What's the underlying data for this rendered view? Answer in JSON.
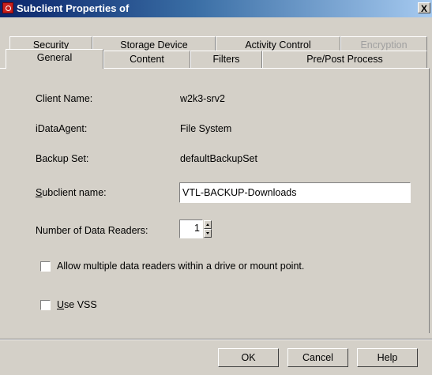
{
  "window": {
    "title": "Subclient Properties of",
    "close_glyph": "X"
  },
  "tabs": {
    "back_row": [
      {
        "label": "Security",
        "disabled": false
      },
      {
        "label": "Storage Device",
        "disabled": false
      },
      {
        "label": "Activity Control",
        "disabled": false
      },
      {
        "label": "Encryption",
        "disabled": true
      }
    ],
    "front_row": [
      {
        "label": "General",
        "selected": true
      },
      {
        "label": "Content",
        "selected": false
      },
      {
        "label": "Filters",
        "selected": false
      },
      {
        "label": "Pre/Post Process",
        "selected": false
      }
    ]
  },
  "general": {
    "client_name_label": "Client Name:",
    "client_name_value": "w2k3-srv2",
    "idataagent_label": "iDataAgent:",
    "idataagent_value": "File System",
    "backup_set_label": "Backup Set:",
    "backup_set_value": "defaultBackupSet",
    "subclient_name_label_mnemonic": "S",
    "subclient_name_label_rest": "ubclient name:",
    "subclient_name_value": "VTL-BACKUP-Downloads",
    "data_readers_label": "Number of Data Readers:",
    "data_readers_value": "1",
    "allow_multiple_label": "Allow multiple data readers within a drive or mount point.",
    "allow_multiple_checked": false,
    "use_vss_mnemonic": "U",
    "use_vss_rest": "se VSS",
    "use_vss_checked": false
  },
  "buttons": {
    "ok": "OK",
    "cancel": "Cancel",
    "help": "Help"
  },
  "colors": {
    "title_gradient_start": "#0a246a",
    "title_gradient_end": "#a6caf0",
    "dialog_bg": "#d4d0c8"
  }
}
